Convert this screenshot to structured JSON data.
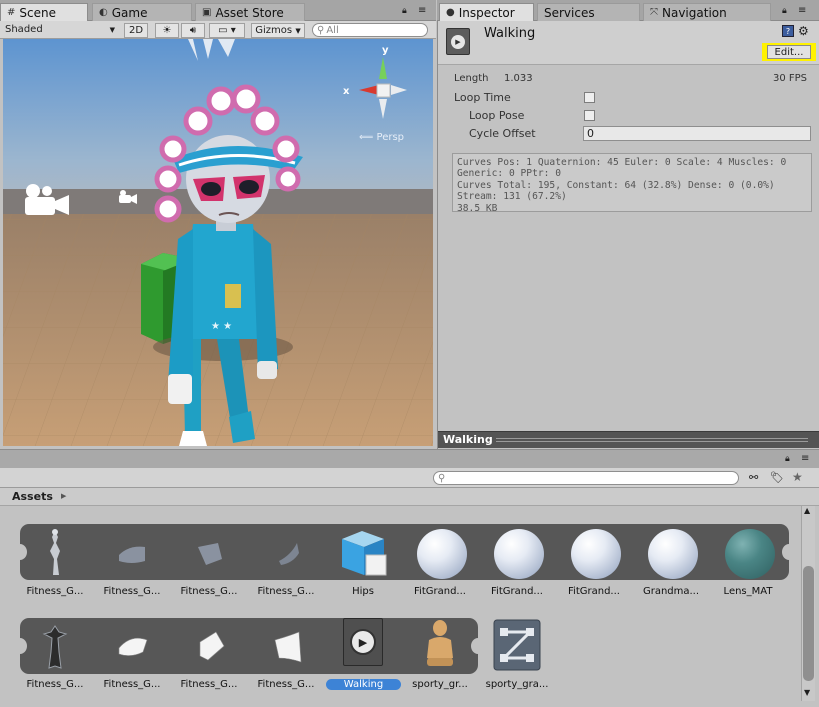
{
  "scene_tabs": [
    {
      "label": "Scene",
      "icon": "grid-icon"
    },
    {
      "label": "Game",
      "icon": "pacman-icon"
    },
    {
      "label": "Asset Store",
      "icon": "store-icon"
    }
  ],
  "scene_toolbar": {
    "shading_mode": "Shaded",
    "mode_2d": "2D",
    "gizmos": "Gizmos",
    "search_placeholder": "All"
  },
  "scene_view": {
    "projection_label": "Persp",
    "axis_y": "y",
    "axis_x": "x"
  },
  "inspector_tabs": [
    {
      "label": "Inspector",
      "icon": "info-icon"
    },
    {
      "label": "Services",
      "icon": ""
    },
    {
      "label": "Navigation",
      "icon": "navigation-icon"
    }
  ],
  "inspector": {
    "asset_name": "Walking",
    "edit_button": "Edit...",
    "length_label": "Length",
    "length_value": "1.033",
    "fps": "30 FPS",
    "loop_time": {
      "label": "Loop Time",
      "checked": false
    },
    "loop_pose": {
      "label": "Loop Pose",
      "checked": false
    },
    "cycle_offset": {
      "label": "Cycle Offset",
      "value": "0"
    },
    "info_text": "Curves Pos: 1 Quaternion: 45 Euler: 0 Scale: 4 Muscles: 0 Generic: 0 PPtr: 0\nCurves Total: 195, Constant: 64 (32.8%) Dense: 0 (0.0%) Stream: 131 (67.2%)\n38.5 KB",
    "preview_title": "Walking"
  },
  "project": {
    "breadcrumb": "Assets",
    "row1": [
      {
        "label": "Fitness_G...",
        "kind": "skeleton"
      },
      {
        "label": "Fitness_G...",
        "kind": "mesh"
      },
      {
        "label": "Fitness_G...",
        "kind": "mesh"
      },
      {
        "label": "Fitness_G...",
        "kind": "mesh"
      },
      {
        "label": "Hips",
        "kind": "cube"
      },
      {
        "label": "FitGrand...",
        "kind": "material"
      },
      {
        "label": "FitGrand...",
        "kind": "material"
      },
      {
        "label": "FitGrand...",
        "kind": "material"
      },
      {
        "label": "Grandma...",
        "kind": "material"
      },
      {
        "label": "Lens_MAT",
        "kind": "material-teal"
      }
    ],
    "row2": [
      {
        "label": "Fitness_G...",
        "kind": "skeleton"
      },
      {
        "label": "Fitness_G...",
        "kind": "mesh-white"
      },
      {
        "label": "Fitness_G...",
        "kind": "mesh-white"
      },
      {
        "label": "Fitness_G...",
        "kind": "mesh-white"
      },
      {
        "label": "Walking",
        "kind": "animation",
        "selected": true
      },
      {
        "label": "sporty_gr...",
        "kind": "avatar"
      },
      {
        "label": "sporty_gra...",
        "kind": "controller"
      }
    ]
  },
  "colors": {
    "selection": "#3d83d6",
    "highlight": "#fff200",
    "teal": "#3f7878"
  }
}
